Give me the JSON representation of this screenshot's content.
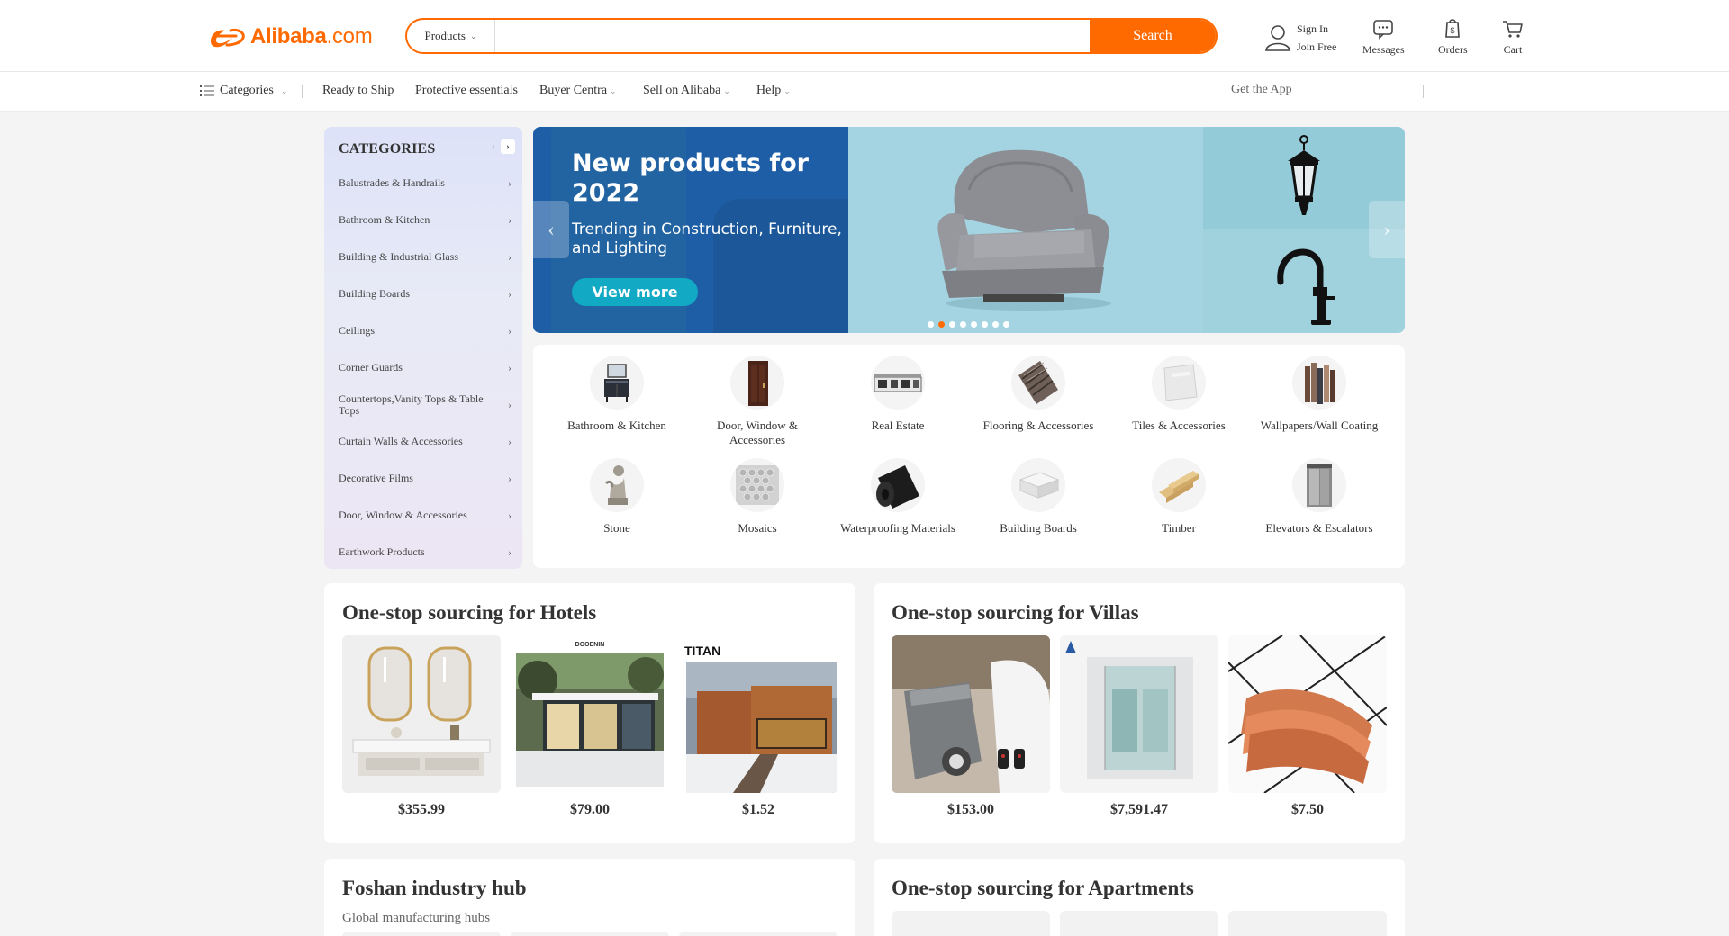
{
  "header": {
    "logo": {
      "brand": "Alibaba",
      "tld": ".com"
    },
    "search": {
      "category": "Products",
      "placeholder": "",
      "button": "Search"
    },
    "account": {
      "sign_in": "Sign In",
      "join": "Join Free"
    },
    "messages": "Messages",
    "orders": "Orders",
    "cart": "Cart"
  },
  "nav": {
    "categories": "Categories",
    "ready_to_ship": "Ready to Ship",
    "protective": "Protective essentials",
    "buyer_central": "Buyer Centra",
    "sell": "Sell on Alibaba",
    "help": "Help",
    "get_app": "Get the App"
  },
  "sidebar": {
    "title": "CATEGORIES",
    "items": [
      {
        "label": "Balustrades & Handrails"
      },
      {
        "label": "Bathroom & Kitchen"
      },
      {
        "label": "Building & Industrial Glass"
      },
      {
        "label": "Building Boards"
      },
      {
        "label": "Ceilings"
      },
      {
        "label": "Corner Guards"
      },
      {
        "label": "Countertops,Vanity Tops & Table Tops"
      },
      {
        "label": "Curtain Walls & Accessories"
      },
      {
        "label": "Decorative Films"
      },
      {
        "label": "Door, Window & Accessories"
      },
      {
        "label": "Earthwork Products"
      }
    ]
  },
  "banner": {
    "title": "New products for 2022",
    "subtitle": "Trending in Construction, Furniture, and Lighting",
    "button": "View more",
    "slide_count": 8,
    "active_slide": 2
  },
  "tiles": [
    {
      "label": "Bathroom & Kitchen",
      "icon": "vanity-cabinet-icon"
    },
    {
      "label": "Door, Window & Accessories",
      "icon": "wooden-door-icon"
    },
    {
      "label": "Real Estate",
      "icon": "modular-house-icon"
    },
    {
      "label": "Flooring & Accessories",
      "icon": "floor-planks-icon"
    },
    {
      "label": "Tiles & Accessories",
      "icon": "tile-icon"
    },
    {
      "label": "Wallpapers/Wall Coating",
      "icon": "wall-panels-icon"
    },
    {
      "label": "Stone",
      "icon": "stone-statue-icon"
    },
    {
      "label": "Mosaics",
      "icon": "mosaic-icon"
    },
    {
      "label": "Waterproofing Materials",
      "icon": "membrane-roll-icon"
    },
    {
      "label": "Building Boards",
      "icon": "board-stack-icon"
    },
    {
      "label": "Timber",
      "icon": "timber-beams-icon"
    },
    {
      "label": "Elevators & Escalators",
      "icon": "elevator-icon"
    }
  ],
  "cards": {
    "hotels": {
      "title": "One-stop sourcing for Hotels",
      "products": [
        {
          "price": "$355.99",
          "icon": "bathroom-vanity-icon"
        },
        {
          "price": "$79.00",
          "icon": "modern-house-icon",
          "brand": "DOOENIN"
        },
        {
          "price": "$1.52",
          "icon": "wood-cladding-house-icon",
          "brand": "TITAN"
        }
      ]
    },
    "villas": {
      "title": "One-stop sourcing for Villas",
      "products": [
        {
          "price": "$153.00",
          "icon": "gate-opener-icon"
        },
        {
          "price": "$7,591.47",
          "icon": "glass-elevator-icon"
        },
        {
          "price": "$7.50",
          "icon": "terracotta-tile-icon"
        }
      ]
    },
    "foshan": {
      "title": "Foshan industry hub",
      "subtitle": "Global manufacturing hubs"
    },
    "apartments": {
      "title": "One-stop sourcing for Apartments"
    }
  },
  "colors": {
    "brand": "#ff6a00",
    "banner_blue": "#1e5ea6",
    "banner_teal": "#a4d4e1",
    "button_teal": "#12a9c4"
  }
}
